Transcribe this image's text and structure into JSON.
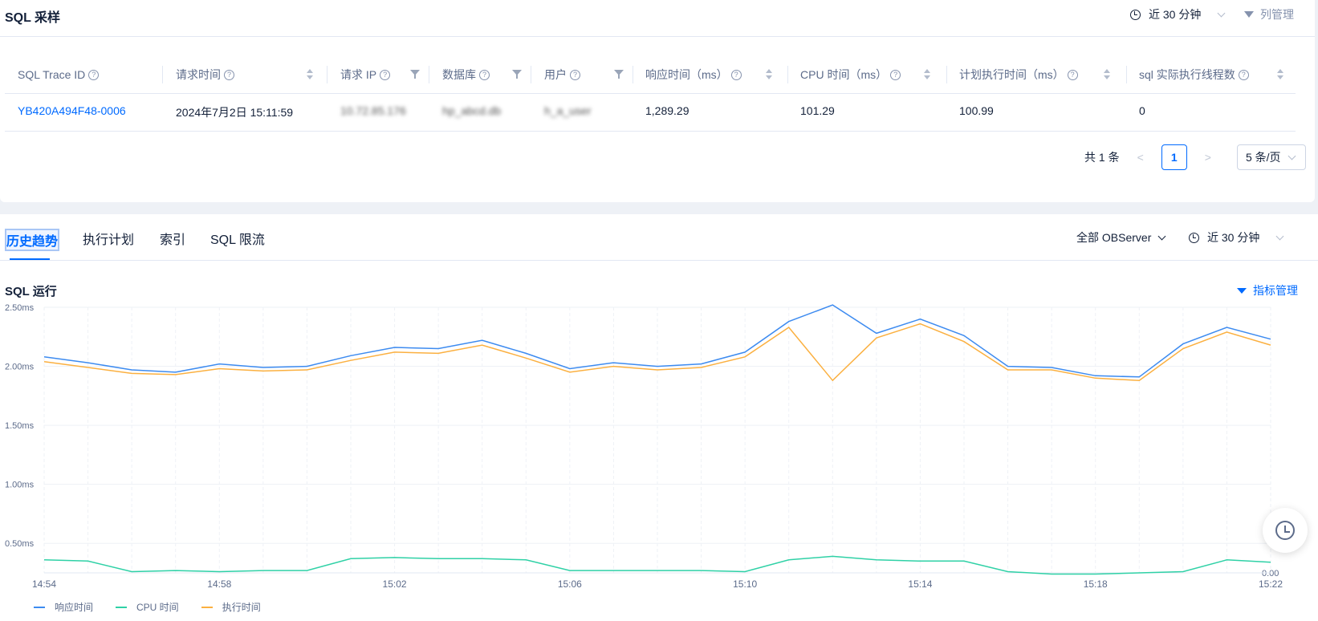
{
  "sample": {
    "title": "SQL 采样",
    "time_range": "近 30 分钟",
    "column_manage": "列管理",
    "columns": [
      "SQL Trace ID",
      "请求时间",
      "请求 IP",
      "数据库",
      "用户",
      "响应时间（ms）",
      "CPU 时间（ms）",
      "计划执行时间（ms）",
      "sql 实际执行线程数"
    ],
    "row": {
      "trace_id": "YB420A494F48-0006",
      "request_time": "2024年7月2日 15:11:59",
      "ip": "10.72.85.176",
      "database": "hp_abcd.db",
      "user": "h_a_user",
      "response_ms": "1,289.29",
      "cpu_ms": "101.29",
      "plan_ms": "100.99",
      "threads": "0"
    },
    "pagination": {
      "total": "共 1 条",
      "current_page": "1",
      "page_size": "5 条/页",
      "prev": "<",
      "next": ">"
    }
  },
  "tabs": [
    "历史趋势",
    "执行计划",
    "索引",
    "SQL 限流"
  ],
  "filters": {
    "observer": "全部 OBServer",
    "time_range": "近 30 分钟"
  },
  "chart_section": {
    "title": "SQL 运行",
    "metric_manage": "指标管理"
  },
  "colors": {
    "accent": "#006aff",
    "response": "#3d8bf0",
    "cpu": "#2fd1a6",
    "exec": "#fbb040"
  },
  "chart_data": {
    "type": "line",
    "x": [
      "14:54",
      "14:55",
      "14:56",
      "14:57",
      "14:58",
      "14:59",
      "15:00",
      "15:01",
      "15:02",
      "15:03",
      "15:04",
      "15:05",
      "15:06",
      "15:07",
      "15:08",
      "15:09",
      "15:10",
      "15:11",
      "15:12",
      "15:13",
      "15:14",
      "15:15",
      "15:16",
      "15:17",
      "15:18",
      "15:19",
      "15:20",
      "15:21",
      "15:22"
    ],
    "x_tick_labels": [
      "14:54",
      "14:58",
      "15:02",
      "15:06",
      "15:10",
      "15:14",
      "15:18",
      "15:22"
    ],
    "y_ticks_left": [
      "2.50ms",
      "2.00ms",
      "1.50ms",
      "1.00ms",
      "0.50ms"
    ],
    "y_tick_right": "0.00",
    "ylim": [
      0.25,
      2.5
    ],
    "series": [
      {
        "name": "响应时间",
        "color": "#3d8bf0",
        "values": [
          2.08,
          2.03,
          1.97,
          1.95,
          2.02,
          1.99,
          2.0,
          2.09,
          2.16,
          2.15,
          2.22,
          2.11,
          1.98,
          2.03,
          2.0,
          2.02,
          2.12,
          2.38,
          2.52,
          2.28,
          2.4,
          2.26,
          2.0,
          1.99,
          1.92,
          1.91,
          2.19,
          2.33,
          2.23
        ]
      },
      {
        "name": "CPU 时间",
        "color": "#2fd1a6",
        "values": [
          0.36,
          0.35,
          0.26,
          0.27,
          0.26,
          0.27,
          0.27,
          0.37,
          0.38,
          0.37,
          0.37,
          0.36,
          0.27,
          0.27,
          0.27,
          0.27,
          0.26,
          0.36,
          0.39,
          0.36,
          0.35,
          0.35,
          0.26,
          0.24,
          0.24,
          0.25,
          0.26,
          0.36,
          0.34
        ]
      },
      {
        "name": "执行时间",
        "color": "#fbb040",
        "values": [
          2.04,
          1.99,
          1.94,
          1.93,
          1.98,
          1.96,
          1.97,
          2.05,
          2.12,
          2.11,
          2.18,
          2.07,
          1.95,
          2.0,
          1.97,
          1.99,
          2.08,
          2.33,
          1.88,
          2.24,
          2.36,
          2.21,
          1.97,
          1.97,
          1.9,
          1.88,
          2.15,
          2.29,
          2.18
        ]
      }
    ]
  }
}
